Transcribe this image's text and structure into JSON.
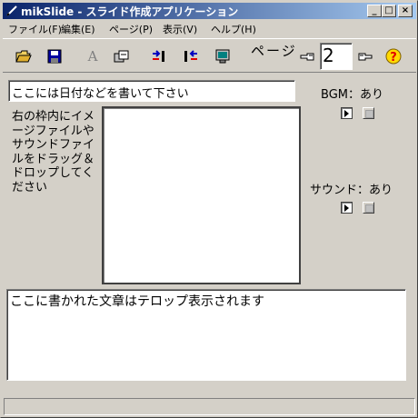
{
  "window": {
    "title": "mikSlide - スライド作成アプリケーション",
    "controls": {
      "minimize": "_",
      "maximize": "□",
      "close": "×"
    }
  },
  "menu": [
    {
      "label": "ファイル(F)"
    },
    {
      "label": "編集(E)"
    },
    {
      "label": "ページ(P)"
    },
    {
      "label": "表示(V)"
    },
    {
      "label": "ヘルプ(H)"
    }
  ],
  "toolbar": {
    "tools": [
      {
        "name": "open-folder-icon"
      },
      {
        "name": "save-disk-icon"
      },
      {
        "name": "font-a-icon",
        "glyph": "A"
      },
      {
        "name": "insert-image-icon"
      },
      {
        "name": "insert-page-icon"
      },
      {
        "name": "delete-page-icon"
      },
      {
        "name": "monitor-preview-icon"
      }
    ],
    "page_label": "ページ",
    "page_value": "2",
    "prev_icon": "pointing-hand-left-icon",
    "next_icon": "pointing-hand-right-icon",
    "help_icon": "help-question-icon"
  },
  "date_field": {
    "value": "ここには日付などを書いて下さい"
  },
  "bgm": {
    "label": "BGM：あり"
  },
  "sound": {
    "label": "サウンド：あり"
  },
  "instructions": "右の枠内にイメージファイルやサウンドファイルをドラッグ＆ドロップしてください",
  "telop": {
    "value": "ここに書かれた文章はテロップ表示されます"
  },
  "colors": {
    "titlebar_start": "#0a246a",
    "titlebar_end": "#a6caf0",
    "face": "#d4d0c8"
  }
}
